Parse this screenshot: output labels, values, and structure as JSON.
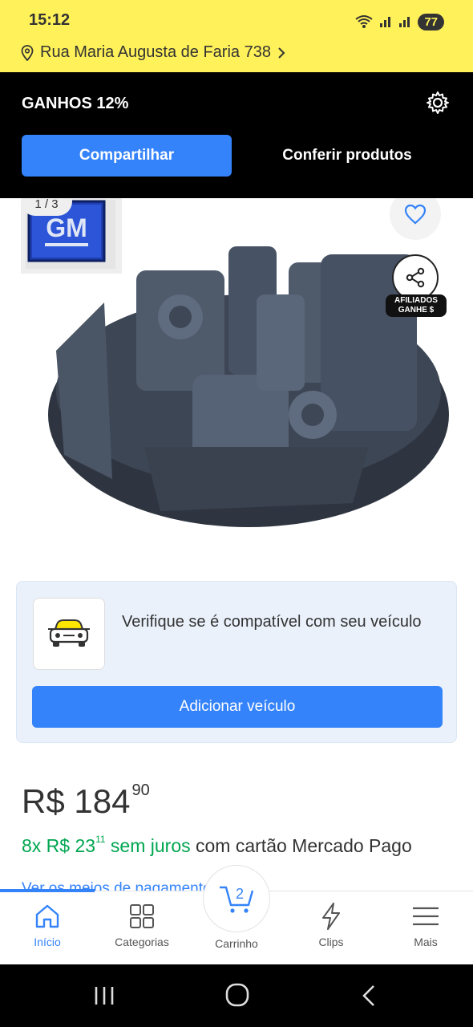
{
  "status": {
    "time": "15:12",
    "battery": "77"
  },
  "address": {
    "text": "Rua Maria Augusta de Faria 738"
  },
  "affiliates": {
    "title": "GANHOS 12%",
    "share_label": "Compartilhar",
    "check_label": "Conferir produtos"
  },
  "gallery": {
    "pager": "1 / 3",
    "brand_logo_text": "GM",
    "affiliate_badge_line1": "AFILIADOS",
    "affiliate_badge_line2": "GANHE $"
  },
  "compat": {
    "text": "Verifique se é compatível com seu veículo",
    "button_label": "Adicionar veículo"
  },
  "price": {
    "currency": "R$",
    "integer": "184",
    "cents": "90",
    "installments_prefix": "8x R$ 23",
    "installments_cents": "11",
    "installments_no_interest": "sem juros",
    "installments_suffix": "com cartão Mercado Pago",
    "payment_link": "Ver os meios de pagamento"
  },
  "bottom_nav": {
    "items": [
      {
        "label": "Início",
        "icon": "home-icon"
      },
      {
        "label": "Categorias",
        "icon": "grid-icon"
      },
      {
        "label": "Carrinho",
        "icon": "cart-icon",
        "badge": "2"
      },
      {
        "label": "Clips",
        "icon": "bolt-icon"
      },
      {
        "label": "Mais",
        "icon": "menu-icon"
      }
    ]
  },
  "colors": {
    "header_yellow": "#fff159",
    "accent_blue": "#3483fa",
    "green": "#00a650"
  }
}
